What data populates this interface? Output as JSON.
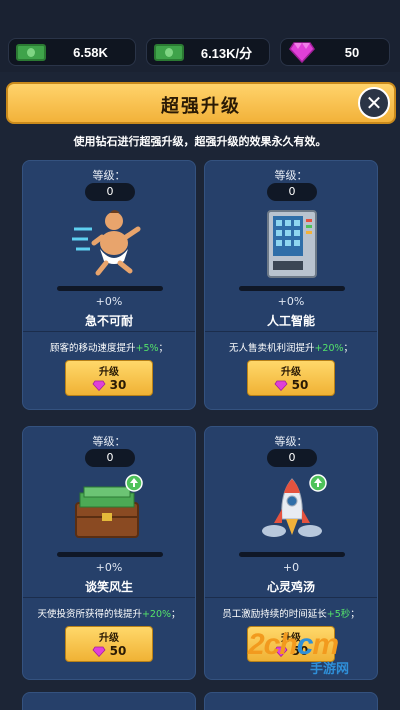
{
  "resources": {
    "cash": "6.58K",
    "income": "6.13K/分",
    "gems": "50"
  },
  "header": {
    "title": "超强升级",
    "close": "✕",
    "subtitle": "使用钻石进行超强升级，超强升级的效果永久有效。"
  },
  "cards": [
    {
      "level_label": "等级：",
      "level": "0",
      "progress": 0,
      "percent": "+0%",
      "name": "急不可耐",
      "desc_prefix": "顾客的移动速度提升",
      "desc_value": "+5%",
      "desc_suffix": "；",
      "upgrade_label": "升级",
      "cost": "30",
      "icon": "running-baby-icon"
    },
    {
      "level_label": "等级：",
      "level": "0",
      "progress": 0,
      "percent": "+0%",
      "name": "人工智能",
      "desc_prefix": "无人售卖机利润提升",
      "desc_value": "+20%",
      "desc_suffix": "；",
      "upgrade_label": "升级",
      "cost": "50",
      "icon": "vending-machine-icon"
    },
    {
      "level_label": "等级：",
      "level": "0",
      "progress": 0,
      "percent": "+0%",
      "name": "谈笑风生",
      "desc_prefix": "天使投资所获得的钱提升",
      "desc_value": "+20%",
      "desc_suffix": "；",
      "upgrade_label": "升级",
      "cost": "50",
      "icon": "money-case-icon"
    },
    {
      "level_label": "等级：",
      "level": "0",
      "progress": 0,
      "percent": "+0",
      "name": "心灵鸡汤",
      "desc_prefix": "员工激励持续的时间延长",
      "desc_value": "+5秒",
      "desc_suffix": "；",
      "upgrade_label": "升级",
      "cost": "50",
      "icon": "rocket-icon"
    }
  ],
  "watermark": {
    "logo_main": "2ch",
    "logo_accent": "c",
    "logo_tail": "m",
    "sub": "手游网"
  },
  "colors": {
    "background": "#1c2536",
    "card": "#26406a",
    "accent_gold": "#f2b23a",
    "gem_pink": "#e040d8",
    "bonus_green": "#54e26a"
  }
}
